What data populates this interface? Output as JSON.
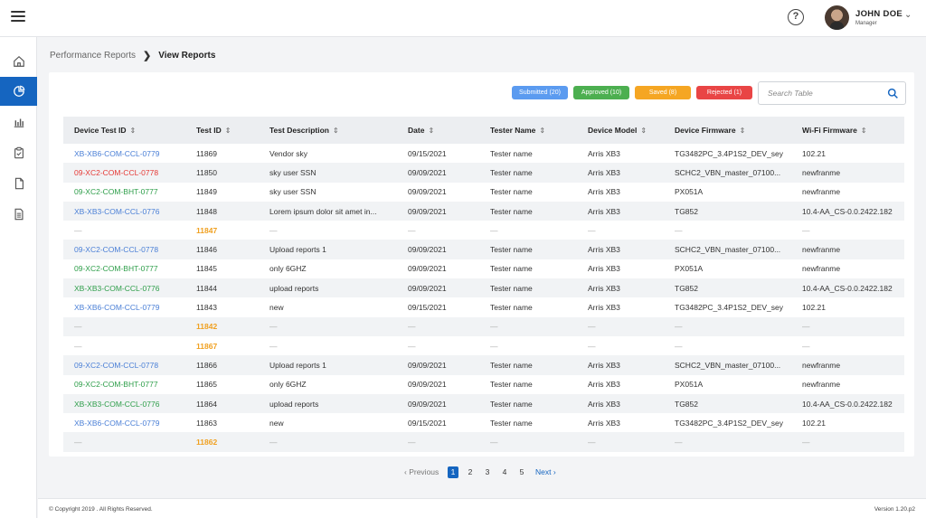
{
  "header": {
    "user_name": "JOHN DOE",
    "user_role": "Manager",
    "help_label": "?"
  },
  "breadcrumb": {
    "parent": "Performance Reports",
    "separator": "❯",
    "current": "View Reports"
  },
  "filters": [
    {
      "label": "Submitted (20)",
      "color": "#5b9bf0"
    },
    {
      "label": "Approved (10)",
      "color": "#4caf50"
    },
    {
      "label": "Saved (8)",
      "color": "#f5a623"
    },
    {
      "label": "Rejected (1)",
      "color": "#e94545"
    }
  ],
  "search": {
    "placeholder": "Search Table"
  },
  "table": {
    "columns": [
      "Device Test ID",
      "Test ID",
      "Test Description",
      "Date",
      "Tester Name",
      "Device Model",
      "Device Firmware",
      "Wi-Fi Firmware"
    ],
    "rows": [
      [
        "XB-XB6-COM-CCL-0779",
        "11869",
        "Vendor sky",
        "09/15/2021",
        "Tester name",
        "Arris XB3",
        "TG3482PC_3.4P1S2_DEV_sey",
        "102.21"
      ],
      [
        "09-XC2-COM-CCL-0778",
        "11850",
        "sky user SSN",
        "09/09/2021",
        "Tester name",
        "Arris XB3",
        "SCHC2_VBN_master_07100...",
        "newfranme"
      ],
      [
        "09-XC2-COM-BHT-0777",
        "11849",
        "sky user SSN",
        "09/09/2021",
        "Tester name",
        "Arris XB3",
        "PX051A",
        "newfranme"
      ],
      [
        "XB-XB3-COM-CCL-0776",
        "11848",
        "Lorem ipsum dolor sit amet in...",
        "09/09/2021",
        "Tester name",
        "Arris XB3",
        "TG852",
        "10.4-AA_CS-0.0.2422.182"
      ],
      [
        "—",
        "11847",
        "—",
        "—",
        "—",
        "—",
        "—",
        "—"
      ],
      [
        "09-XC2-COM-CCL-0778",
        "11846",
        "Upload reports 1",
        "09/09/2021",
        "Tester name",
        "Arris XB3",
        "SCHC2_VBN_master_07100...",
        "newfranme"
      ],
      [
        "09-XC2-COM-BHT-0777",
        "11845",
        "only 6GHZ",
        "09/09/2021",
        "Tester name",
        "Arris XB3",
        "PX051A",
        "newfranme"
      ],
      [
        "XB-XB3-COM-CCL-0776",
        "11844",
        "upload reports",
        "09/09/2021",
        "Tester name",
        "Arris XB3",
        "TG852",
        "10.4-AA_CS-0.0.2422.182"
      ],
      [
        "XB-XB6-COM-CCL-0779",
        "11843",
        "new",
        "09/15/2021",
        "Tester name",
        "Arris XB3",
        "TG3482PC_3.4P1S2_DEV_sey",
        "102.21"
      ],
      [
        "—",
        "11842",
        "—",
        "—",
        "—",
        "—",
        "—",
        "—"
      ],
      [
        "—",
        "11867",
        "—",
        "—",
        "—",
        "—",
        "—",
        "—"
      ],
      [
        "09-XC2-COM-CCL-0778",
        "11866",
        "Upload reports 1",
        "09/09/2021",
        "Tester name",
        "Arris XB3",
        "SCHC2_VBN_master_07100...",
        "newfranme"
      ],
      [
        "09-XC2-COM-BHT-0777",
        "11865",
        "only 6GHZ",
        "09/09/2021",
        "Tester name",
        "Arris XB3",
        "PX051A",
        "newfranme"
      ],
      [
        "XB-XB3-COM-CCL-0776",
        "11864",
        "upload reports",
        "09/09/2021",
        "Tester name",
        "Arris XB3",
        "TG852",
        "10.4-AA_CS-0.0.2422.182"
      ],
      [
        "XB-XB6-COM-CCL-0779",
        "11863",
        "new",
        "09/15/2021",
        "Tester name",
        "Arris XB3",
        "TG3482PC_3.4P1S2_DEV_sey",
        "102.21"
      ],
      [
        "—",
        "11862",
        "—",
        "—",
        "—",
        "—",
        "—",
        "—"
      ]
    ],
    "id_colors": [
      "blue",
      "red",
      "green",
      "blue",
      "none",
      "blue",
      "green",
      "green",
      "blue",
      "none",
      "none",
      "blue",
      "green",
      "green",
      "blue",
      "none"
    ]
  },
  "pagination": {
    "prev": "Previous",
    "next": "Next",
    "pages": [
      "1",
      "2",
      "3",
      "4",
      "5"
    ],
    "active": "1"
  },
  "footer": {
    "copyright": "© Copyright 2019 . All Rights Reserved.",
    "version": "Version 1.20.p2"
  },
  "sidebar_icons": [
    "home-icon",
    "pie-chart-icon",
    "bar-chart-icon",
    "clipboard-icon",
    "file-icon",
    "document-icon"
  ],
  "colors": {
    "primary": "#1565c0",
    "id_blue": "#4a7fd6",
    "id_red": "#e53935",
    "id_green": "#2e9e4a",
    "id_orange": "#f0a020"
  }
}
